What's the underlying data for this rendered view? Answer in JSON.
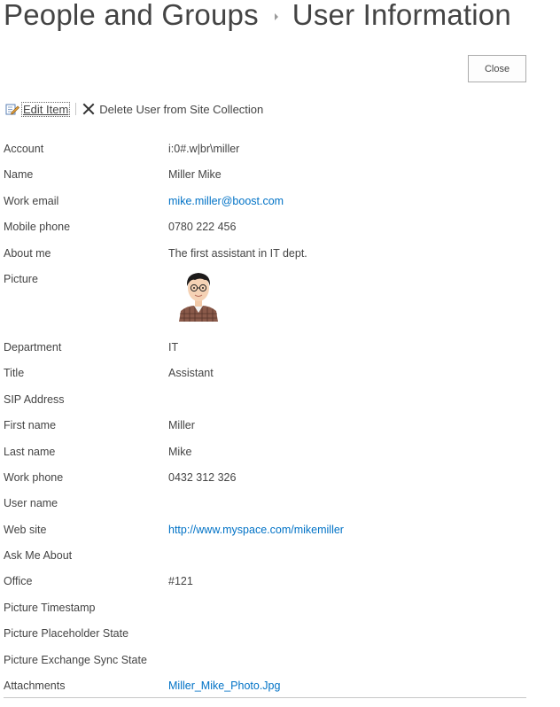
{
  "header": {
    "breadcrumb_parent": "People and Groups",
    "title": "User Information"
  },
  "buttons": {
    "close": "Close"
  },
  "toolbar": {
    "edit_item": "Edit Item",
    "delete_user": "Delete User from Site Collection"
  },
  "fields": {
    "account": {
      "label": "Account",
      "value": "i:0#.w|br\\miller"
    },
    "name": {
      "label": "Name",
      "value": "Miller Mike"
    },
    "work_email": {
      "label": "Work email",
      "value": "mike.miller@boost.com"
    },
    "mobile_phone": {
      "label": "Mobile phone",
      "value": "0780 222 456"
    },
    "about_me": {
      "label": "About me",
      "value": "The first assistant in IT dept."
    },
    "picture": {
      "label": "Picture"
    },
    "department": {
      "label": "Department",
      "value": "IT"
    },
    "title": {
      "label": "Title",
      "value": "Assistant"
    },
    "sip_address": {
      "label": "SIP Address",
      "value": ""
    },
    "first_name": {
      "label": "First name",
      "value": "Miller"
    },
    "last_name": {
      "label": "Last name",
      "value": "Mike"
    },
    "work_phone": {
      "label": "Work phone",
      "value": "0432 312 326"
    },
    "user_name": {
      "label": "User name",
      "value": ""
    },
    "web_site": {
      "label": "Web site",
      "value": "http://www.myspace.com/mikemiller"
    },
    "ask_me_about": {
      "label": "Ask Me About",
      "value": ""
    },
    "office": {
      "label": "Office",
      "value": "#121"
    },
    "picture_timestamp": {
      "label": "Picture Timestamp",
      "value": ""
    },
    "picture_placeholder_state": {
      "label": "Picture Placeholder State",
      "value": ""
    },
    "picture_exchange_sync_state": {
      "label": "Picture Exchange Sync State",
      "value": ""
    },
    "attachments": {
      "label": "Attachments",
      "value": "Miller_Mike_Photo.Jpg"
    }
  },
  "colors": {
    "link": "#0072c6",
    "text": "#444444",
    "divider": "#c6c6c6"
  },
  "icons": {
    "edit": "edit-pencil-icon",
    "delete": "close-x-icon",
    "breadcrumb_separator": "triangle-right-icon"
  }
}
